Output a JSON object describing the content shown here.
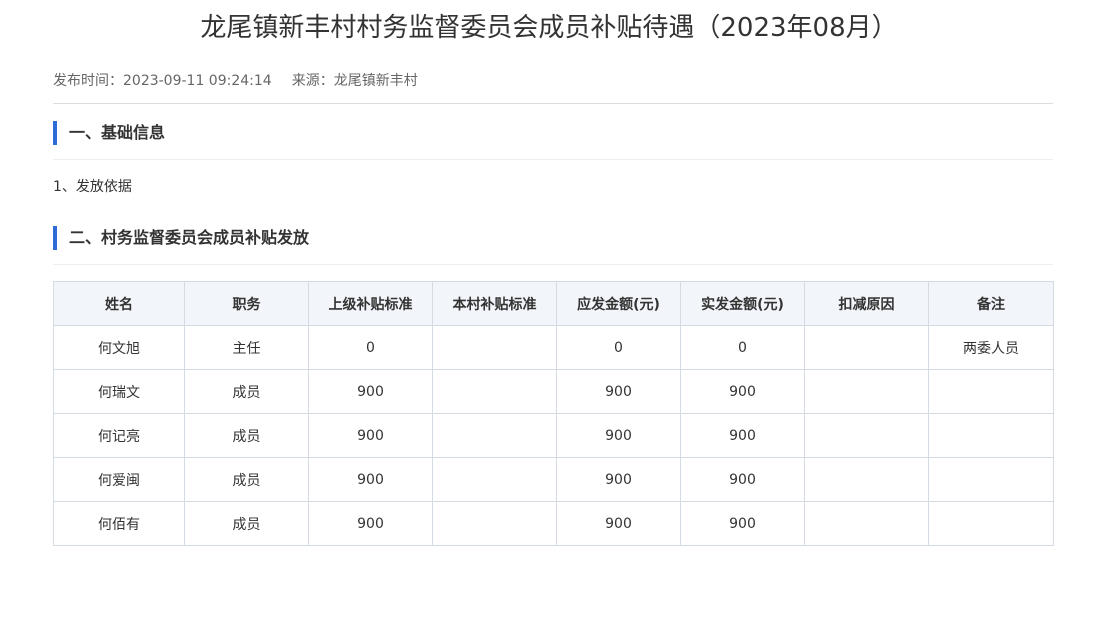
{
  "article": {
    "title": "龙尾镇新丰村村务监督委员会成员补贴待遇（2023年08月）",
    "publish_label": "发布时间：",
    "publish_time": "2023-09-11 09:24:14",
    "source_label": "来源：",
    "source": "龙尾镇新丰村"
  },
  "sections": [
    {
      "heading": "一、基础信息"
    },
    {
      "heading": "二、村务监督委员会成员补贴发放"
    }
  ],
  "basis_text": "1、发放依据",
  "table": {
    "headers": [
      "姓名",
      "职务",
      "上级补贴标准",
      "本村补贴标准",
      "应发金额(元)",
      "实发金额(元)",
      "扣减原因",
      "备注"
    ],
    "rows": [
      [
        "何文旭",
        "主任",
        "0",
        "",
        "0",
        "0",
        "",
        "两委人员"
      ],
      [
        "何瑞文",
        "成员",
        "900",
        "",
        "900",
        "900",
        "",
        ""
      ],
      [
        "何记亮",
        "成员",
        "900",
        "",
        "900",
        "900",
        "",
        ""
      ],
      [
        "何爱闽",
        "成员",
        "900",
        "",
        "900",
        "900",
        "",
        ""
      ],
      [
        "何佰有",
        "成员",
        "900",
        "",
        "900",
        "900",
        "",
        ""
      ]
    ]
  },
  "colors": {
    "accent_bar": "#2f6bd8",
    "header_bg": "#f2f5f9",
    "border": "#d5dbe3"
  }
}
